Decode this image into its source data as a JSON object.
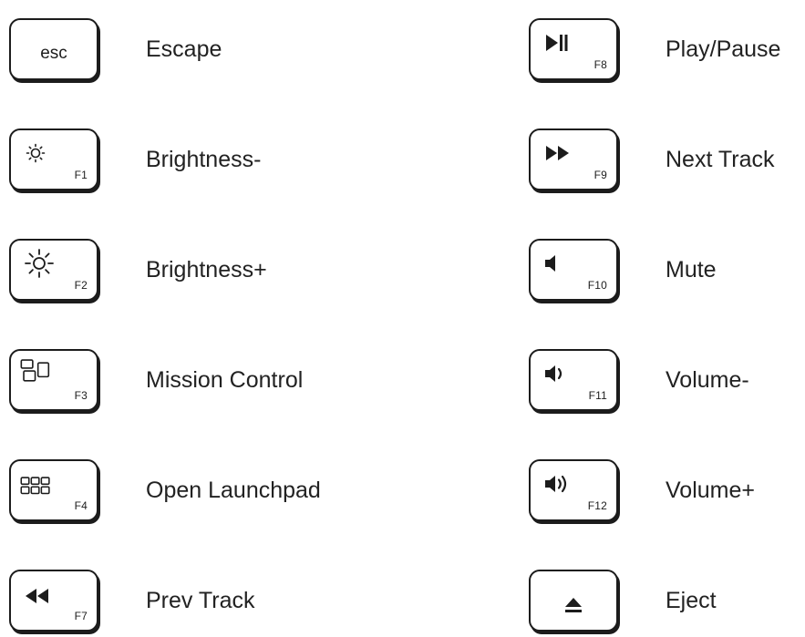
{
  "left_keys": [
    {
      "key": "esc",
      "fn": "",
      "icon": "",
      "label": "Escape"
    },
    {
      "key": "",
      "fn": "F1",
      "icon": "brightness-down-icon",
      "label": "Brightness-"
    },
    {
      "key": "",
      "fn": "F2",
      "icon": "brightness-up-icon",
      "label": "Brightness+"
    },
    {
      "key": "",
      "fn": "F3",
      "icon": "mission-control-icon",
      "label": "Mission Control"
    },
    {
      "key": "",
      "fn": "F4",
      "icon": "launchpad-icon",
      "label": "Open Launchpad"
    },
    {
      "key": "",
      "fn": "F7",
      "icon": "rewind-icon",
      "label": "Prev Track"
    }
  ],
  "right_keys": [
    {
      "key": "",
      "fn": "F8",
      "icon": "play-pause-icon",
      "label": "Play/Pause"
    },
    {
      "key": "",
      "fn": "F9",
      "icon": "fast-forward-icon",
      "label": "Next Track"
    },
    {
      "key": "",
      "fn": "F10",
      "icon": "mute-icon",
      "label": "Mute"
    },
    {
      "key": "",
      "fn": "F11",
      "icon": "volume-down-icon",
      "label": "Volume-"
    },
    {
      "key": "",
      "fn": "F12",
      "icon": "volume-up-icon",
      "label": "Volume+"
    },
    {
      "key": "",
      "fn": "",
      "icon": "eject-icon",
      "label": "Eject"
    }
  ]
}
